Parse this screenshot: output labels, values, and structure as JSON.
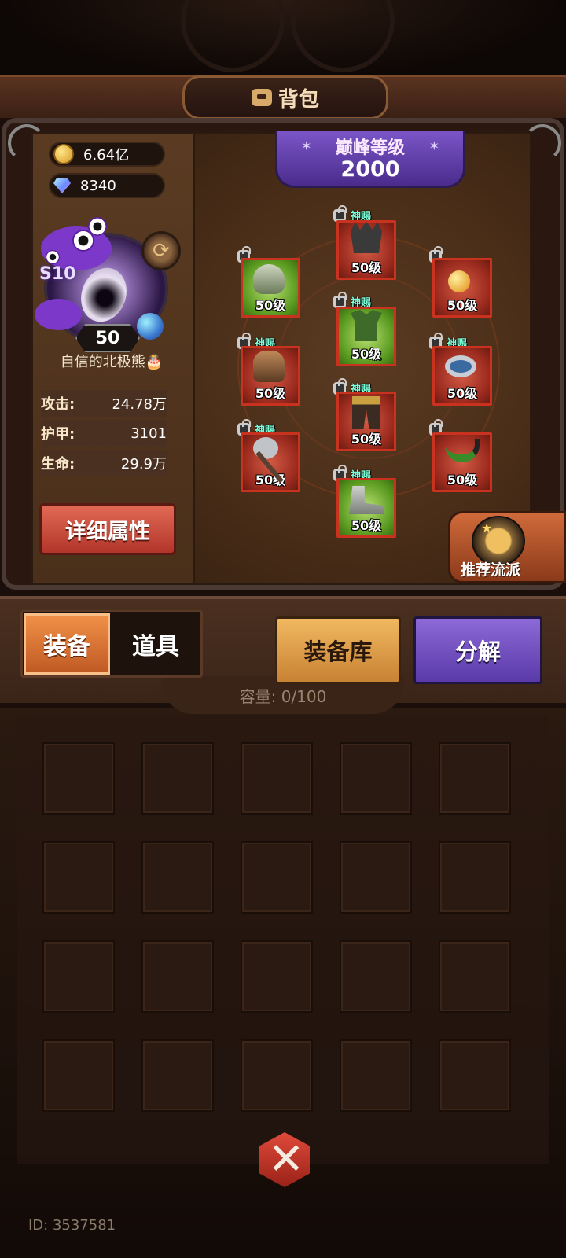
{
  "header": {
    "title": "背包",
    "icon": "bag-icon"
  },
  "currencies": [
    {
      "icon": "gold-coin-icon",
      "value": "6.64亿"
    },
    {
      "icon": "diamond-gem-icon",
      "value": "8340"
    }
  ],
  "player": {
    "season": "S10",
    "level": "50",
    "name": "自信的北极熊🎂"
  },
  "stats": [
    {
      "label": "攻击:",
      "value": "24.78万"
    },
    {
      "label": "护甲:",
      "value": "3101"
    },
    {
      "label": "生命:",
      "value": "29.9万"
    }
  ],
  "detail_button": "详细属性",
  "peak": {
    "label": "巅峰等级",
    "value": "2000"
  },
  "equipment": {
    "helmet": {
      "level": "50级",
      "tag": "神赐",
      "icon": "crown-helmet-icon",
      "rarity": "red"
    },
    "shoulder": {
      "level": "50级",
      "tag": "",
      "icon": "shoulder-armor-icon",
      "rarity": "green"
    },
    "necklace": {
      "level": "50级",
      "tag": "",
      "icon": "amulet-icon",
      "rarity": "red"
    },
    "chest": {
      "level": "50级",
      "tag": "神赐",
      "icon": "chest-armor-icon",
      "rarity": "green"
    },
    "gloves": {
      "level": "50级",
      "tag": "神赐",
      "icon": "gauntlet-icon",
      "rarity": "red"
    },
    "ring": {
      "level": "50级",
      "tag": "神赐",
      "icon": "ring-icon",
      "rarity": "red"
    },
    "pants": {
      "level": "50级",
      "tag": "神赐",
      "icon": "leg-armor-icon",
      "rarity": "red"
    },
    "weapon": {
      "level": "50级",
      "tag": "神赐",
      "icon": "axe-icon",
      "rarity": "red"
    },
    "horn": {
      "level": "50级",
      "tag": "",
      "icon": "horn-icon",
      "rarity": "red"
    },
    "boots": {
      "level": "50级",
      "tag": "神赐",
      "icon": "boots-icon",
      "rarity": "green"
    }
  },
  "recommend_button": "推荐流派",
  "tabs": {
    "equip": "装备",
    "items": "道具"
  },
  "buttons": {
    "warehouse": "装备库",
    "decompose": "分解"
  },
  "capacity": "容量: 0/100",
  "footer_id": "ID: 3537581"
}
